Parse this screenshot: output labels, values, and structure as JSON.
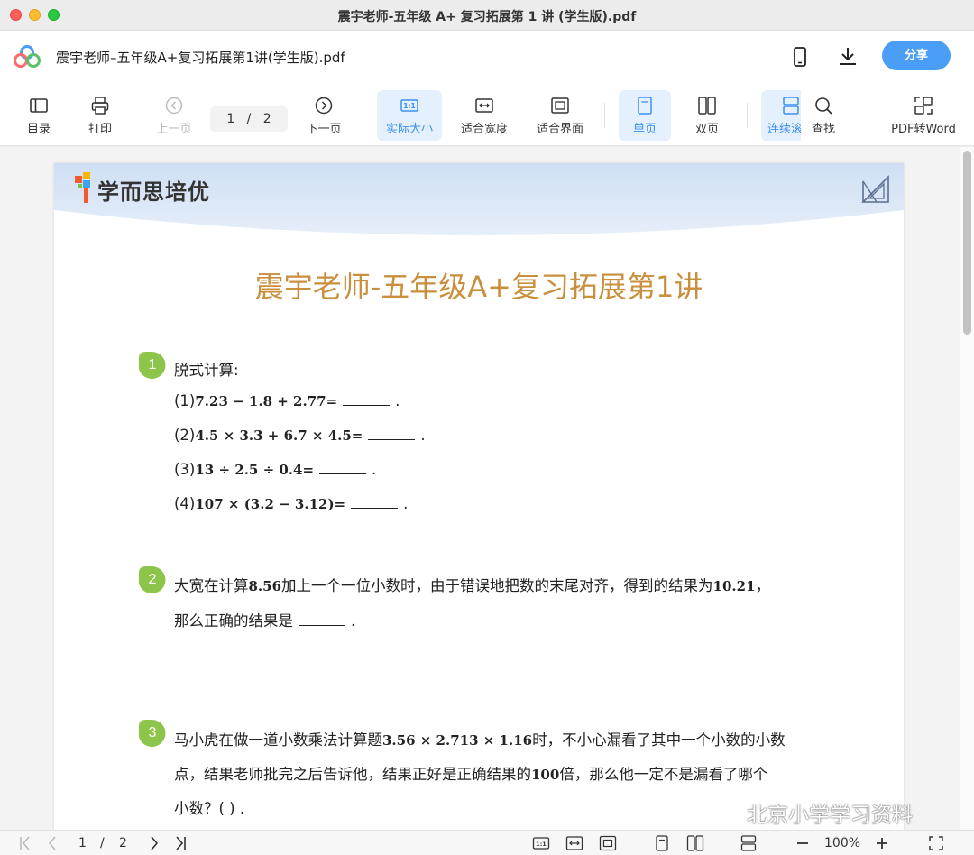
{
  "window": {
    "title": "震宇老师-五年级 A+ 复习拓展第 1 讲 (学生版).pdf"
  },
  "header": {
    "doc_title": "震宇老师–五年级A+复习拓展第1讲(学生版).pdf",
    "share_label": "分享"
  },
  "toolbar": {
    "toc": "目录",
    "print": "打印",
    "prev_page": "上一页",
    "page_current": "1",
    "page_sep": "/",
    "page_total": "2",
    "next_page": "下一页",
    "actual_size": "实际大小",
    "fit_width": "适合宽度",
    "fit_page": "适合界面",
    "single_page": "单页",
    "double_page": "双页",
    "continuous": "连续滚",
    "find": "查找",
    "pdf_to_word": "PDF转Word"
  },
  "document": {
    "brand": "学而思培优",
    "heading": "震宇老师-五年级A+复习拓展第1讲",
    "q1": {
      "num": "1",
      "prompt": "脱式计算:",
      "items": [
        {
          "pre": "(1)",
          "expr": "7.23 − 1.8 + 2.77=",
          "post": "."
        },
        {
          "pre": "(2)",
          "expr": "4.5 × 3.3 + 6.7 × 4.5=",
          "post": "."
        },
        {
          "pre": "(3)",
          "expr": "13 ÷ 2.5 ÷ 0.4=",
          "post": "."
        },
        {
          "pre": "(4)",
          "expr": "107 × (3.2 − 3.12)=",
          "post": "."
        }
      ]
    },
    "q2": {
      "num": "2",
      "line1_a": "大宽在计算",
      "line1_b": "8.56",
      "line1_c": "加上一个一位小数时，由于错误地把数的末尾对齐，得到的结果为",
      "line1_d": "10.21",
      "line1_e": "，",
      "line2_a": "那么正确的结果是",
      "line2_b": "."
    },
    "q3": {
      "num": "3",
      "line1_a": "马小虎在做一道小数乘法计算题",
      "line1_b": "3.56 × 2.713 × 1.16",
      "line1_c": "时，不小心漏看了其中一个小数的小数",
      "line2_a": "点，结果老师批完之后告诉他，结果正好是正确结果的",
      "line2_b": "100",
      "line2_c": "倍，那么他一定不是漏看了哪个",
      "line3": "小数？(    ) ."
    }
  },
  "statusbar": {
    "page_current": "1",
    "page_sep": "/",
    "page_total": "2",
    "zoom": "100%"
  },
  "watermark": "北京小学学习资料",
  "colors": {
    "accent": "#4a9ef5",
    "heading": "#c98f3c",
    "badge_green": "#8dc54a"
  }
}
